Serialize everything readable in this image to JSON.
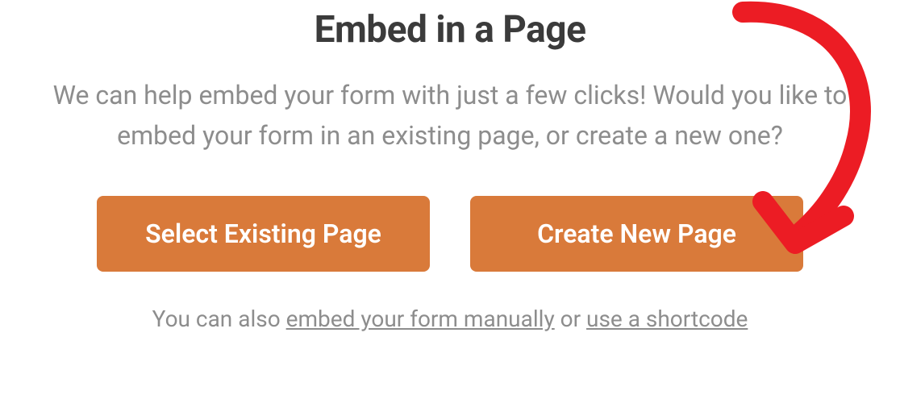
{
  "modal": {
    "title": "Embed in a Page",
    "description": "We can help embed your form with just a few clicks! Would you like to embed your form in an existing page, or create a new one?",
    "buttons": {
      "select_existing": "Select Existing Page",
      "create_new": "Create New Page"
    },
    "footer": {
      "prefix": "You can also ",
      "link_manual": "embed your form manually",
      "middle": " or ",
      "link_shortcode": "use a shortcode"
    }
  },
  "colors": {
    "button_bg": "#d97a3a",
    "title": "#3b3b3b",
    "body_text": "#8d8d8d",
    "annotation": "#ec1c24"
  }
}
